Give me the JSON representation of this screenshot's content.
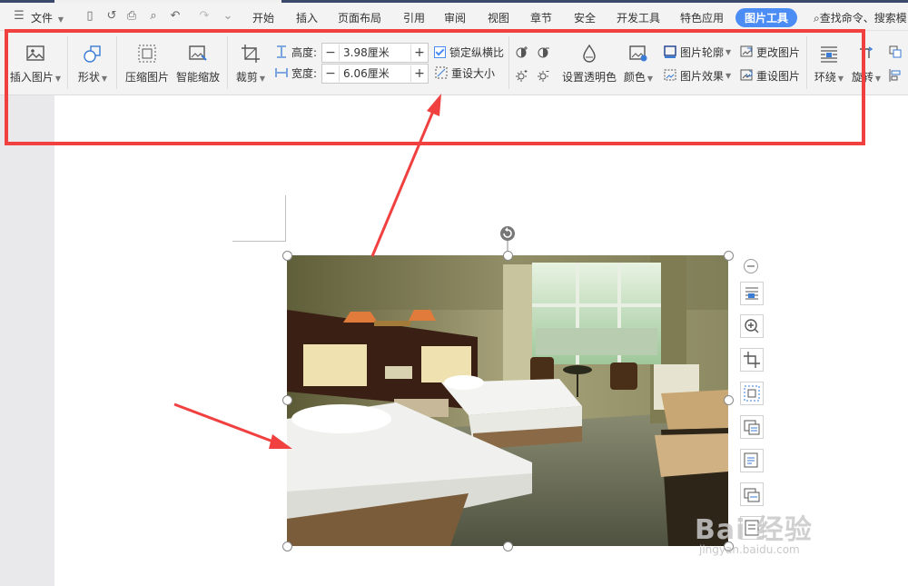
{
  "menubar": {
    "file_label": "文件",
    "tabs": [
      "开始",
      "插入",
      "页面布局",
      "引用",
      "审阅",
      "视图",
      "章节",
      "安全",
      "开发工具",
      "特色应用"
    ],
    "active_tab": "图片工具",
    "search_text": "查找命令、搜索模"
  },
  "ribbon": {
    "insert_picture": "插入图片",
    "shape": "形状",
    "compress_picture": "压缩图片",
    "smart_zoom": "智能缩放",
    "crop": "裁剪",
    "height_label": "高度:",
    "height_value": "3.98厘米",
    "width_label": "宽度:",
    "width_value": "6.06厘米",
    "lock_ratio": "锁定纵横比",
    "reset_size": "重设大小",
    "set_transparent": "设置透明色",
    "color": "颜色",
    "picture_outline": "图片轮廓",
    "picture_effect": "图片效果",
    "change_picture": "更改图片",
    "reset_picture": "重设图片",
    "wrap": "环绕",
    "rotate": "旋转"
  },
  "watermark": {
    "brand": "Bai 经验",
    "url": "jingyan.baidu.com"
  },
  "colors": {
    "accent": "#4b8cf5",
    "annotation_red": "#f04040"
  }
}
